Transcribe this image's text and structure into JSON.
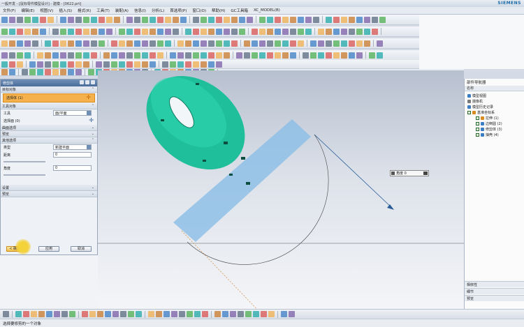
{
  "window": {
    "title": "一般开发 - [鼠标零件模型设计] - 建模 - [0622.prt]",
    "brand": "SIEMENS"
  },
  "menu": {
    "items": [
      "文件(F)",
      "编辑(E)",
      "视图(V)",
      "插入(S)",
      "格式(R)",
      "工具(T)",
      "装配(A)",
      "信息(I)",
      "分析(L)",
      "首选项(P)",
      "窗口(O)",
      "帮助(H)",
      "GC工具箱",
      "XC_MODEL(B)"
    ]
  },
  "dialog": {
    "title": "修剪体",
    "sections": {
      "target": "目标对象",
      "tool": "工具对象",
      "surface_opts": "曲面选项",
      "preview": "预览",
      "settings": "设置",
      "other": "其他选项"
    },
    "rows": {
      "select_body": "选择体 (1)",
      "tool_label": "工具",
      "tool_value": "面/平面",
      "select_face": "选择面 (0)",
      "distance_label": "距离",
      "distance_value": "0",
      "angle_label": "角度",
      "angle_value": "0",
      "type_label": "类型",
      "type_value": "新建平面"
    },
    "buttons": {
      "ok": "< 确定 >",
      "apply": "应用",
      "cancel": "取消"
    }
  },
  "viewport": {
    "input_label": "角度 0"
  },
  "navigator": {
    "title": "部件导航器",
    "header": "名称",
    "items": [
      "模型视图",
      "摄像机",
      "模型历史记录",
      "基准坐标系",
      "拉伸 (1)",
      "边倒圆 (2)",
      "修剪体 (3)",
      "抽壳 (4)"
    ],
    "bottom": [
      "相依性",
      "细节",
      "预览"
    ]
  },
  "status": {
    "text": "选择要修剪的一个对象"
  },
  "colors": {
    "model": "#1fbf9c",
    "plane": "#8fc0e6",
    "accent": "#f5b24c"
  }
}
